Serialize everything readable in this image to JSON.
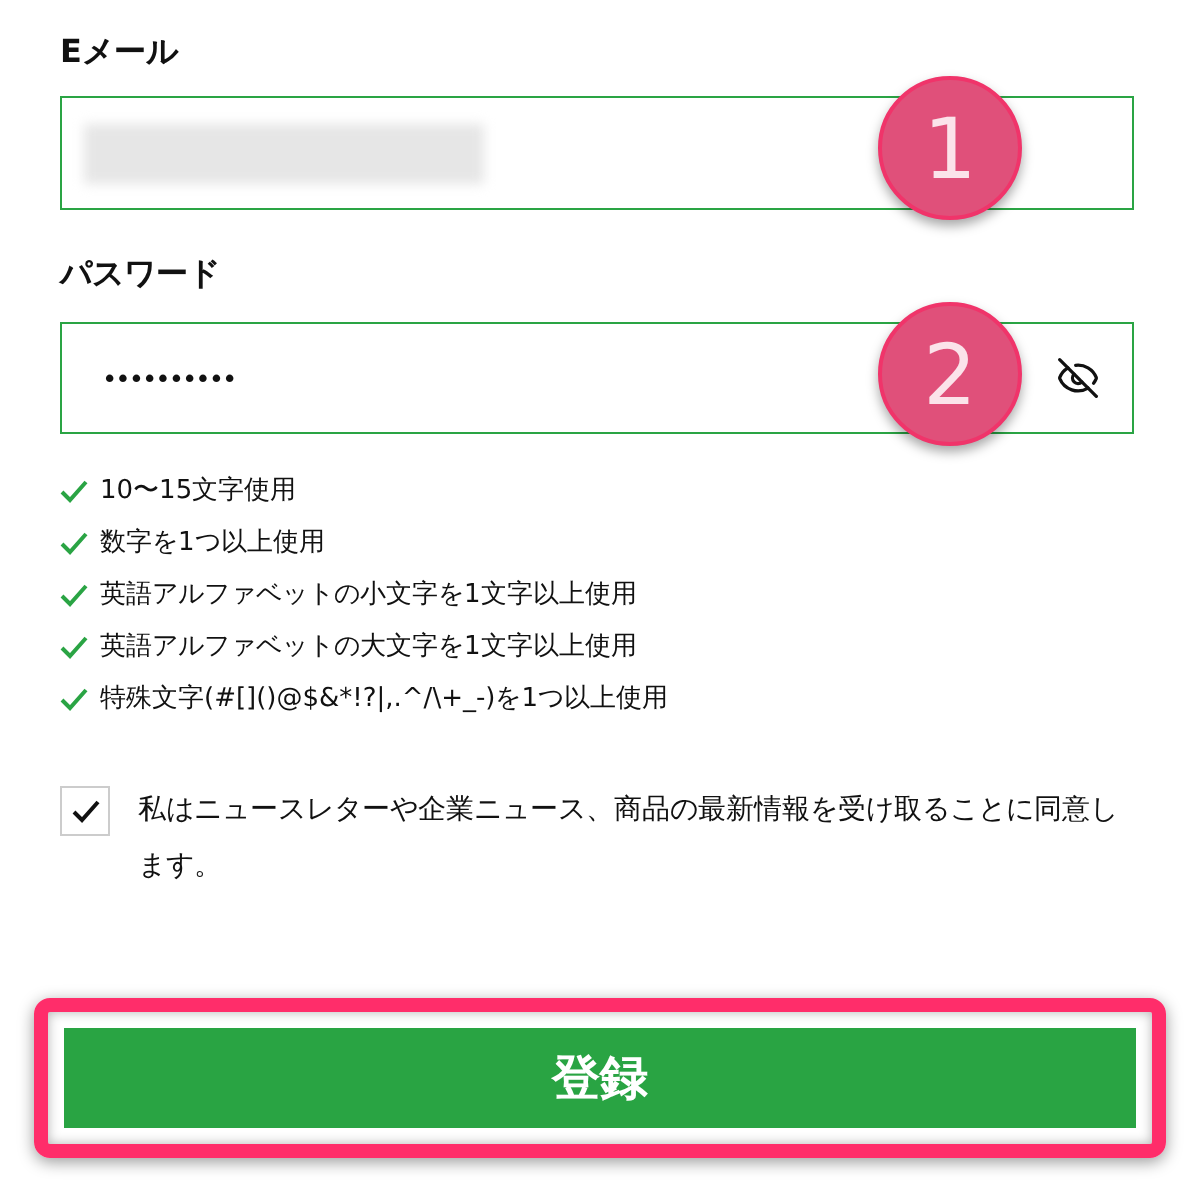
{
  "email": {
    "label": "Eメール",
    "blurred": true
  },
  "password": {
    "label": "パスワード",
    "value": "••••••••••",
    "visible": false
  },
  "rules": [
    {
      "text": "10〜15文字使用",
      "met": true
    },
    {
      "text": "数字を1つ以上使用",
      "met": true
    },
    {
      "text": "英語アルファベットの小文字を1文字以上使用",
      "met": true
    },
    {
      "text": "英語アルファベットの大文字を1文字以上使用",
      "met": true
    },
    {
      "text": "特殊文字(#[]()@$&*!?|,.^/\\+_-)を1つ以上使用",
      "met": true
    }
  ],
  "newsletter": {
    "text": "私はニュースレターや企業ニュース、商品の最新情報を受け取ることに同意します。",
    "checked": true
  },
  "submit": {
    "label": "登録",
    "highlighted": true
  },
  "annotations": [
    {
      "text": "1"
    },
    {
      "text": "2"
    }
  ]
}
